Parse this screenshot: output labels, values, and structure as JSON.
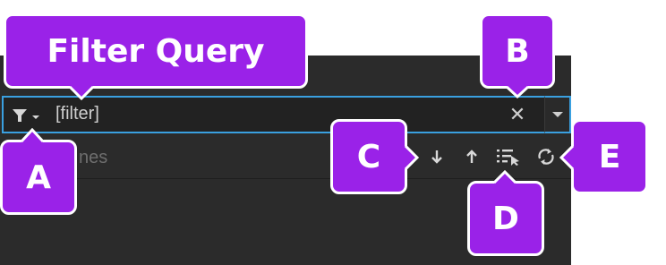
{
  "filter": {
    "value": "[filter]",
    "clear_glyph": "✕",
    "dropdown_icon": "chevron-down-icon",
    "filter_icon": "funnel-icon"
  },
  "list": {
    "header_partial": "nes"
  },
  "toolbar": {
    "icons": [
      "arrow-down-icon",
      "arrow-up-icon",
      "list-select-icon",
      "refresh-icon"
    ]
  },
  "callouts": {
    "filter_query": "Filter Query",
    "a": "A",
    "b": "B",
    "c": "C",
    "d": "D",
    "e": "E"
  },
  "colors": {
    "callout": "#9a22e8",
    "focus_border": "#3aa0e0",
    "panel_bg": "#2b2b2b"
  }
}
